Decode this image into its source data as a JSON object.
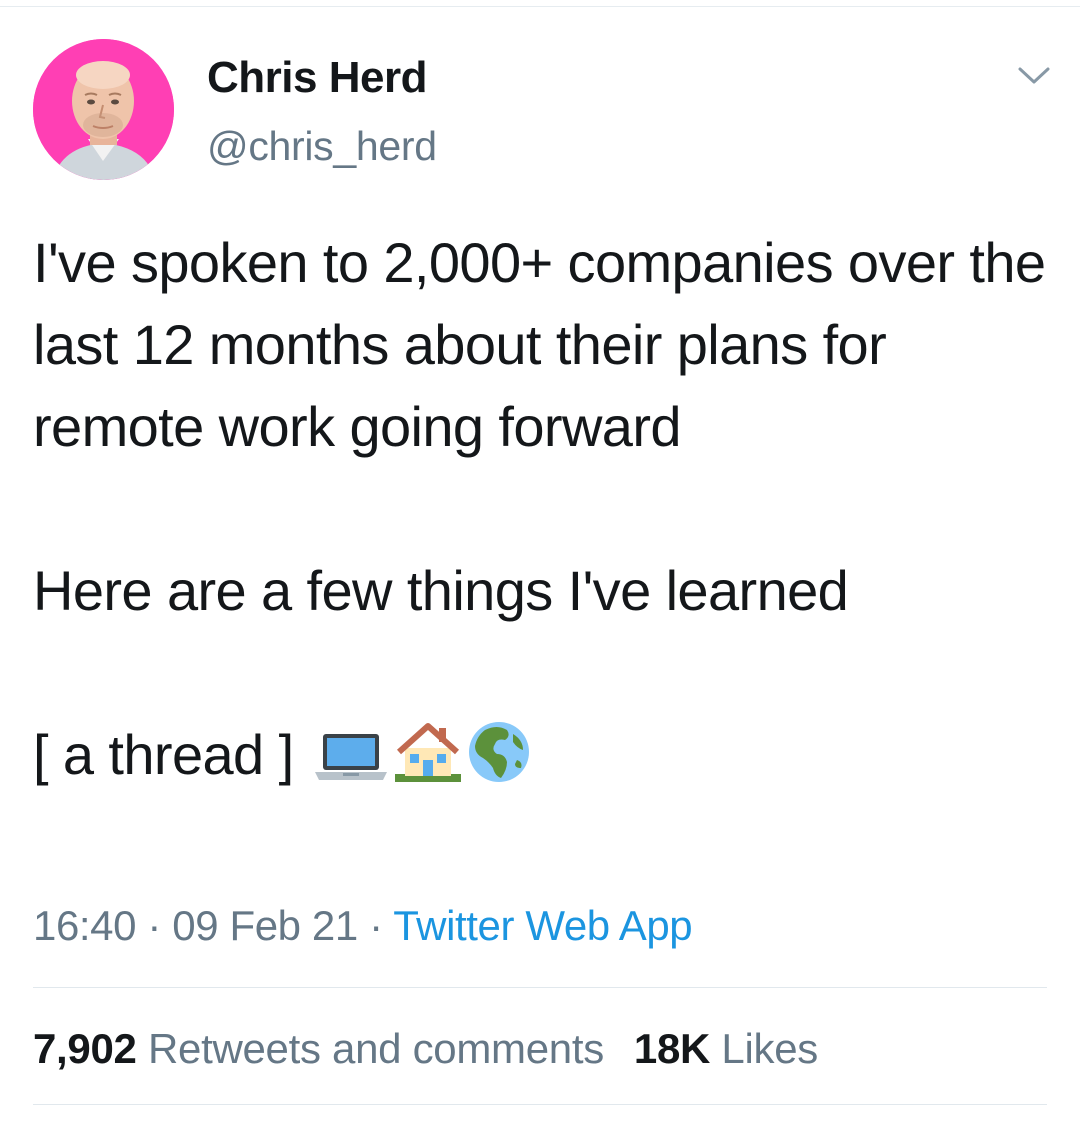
{
  "tweet": {
    "author_name": "Chris Herd",
    "author_handle": "@chris_herd",
    "body_line1": "I've spoken to 2,000+ companies over the last 12 months about their plans for remote work going forward",
    "body_line2": "Here are a few things I've learned",
    "body_line3": "[ a thread ]",
    "emojis": [
      "laptop-emoji",
      "house-with-garden-emoji",
      "globe-emoji"
    ],
    "time": "16:40",
    "separator": "·",
    "date": "09 Feb 21",
    "source": "Twitter Web App"
  },
  "stats": {
    "retweets_count": "7,902",
    "retweets_label": "Retweets and comments",
    "likes_count": "18K",
    "likes_label": "Likes"
  },
  "colors": {
    "avatar_bg": "#ff3fb4",
    "link": "#1b95e0",
    "secondary_text": "#657786",
    "primary_text": "#14171a"
  }
}
